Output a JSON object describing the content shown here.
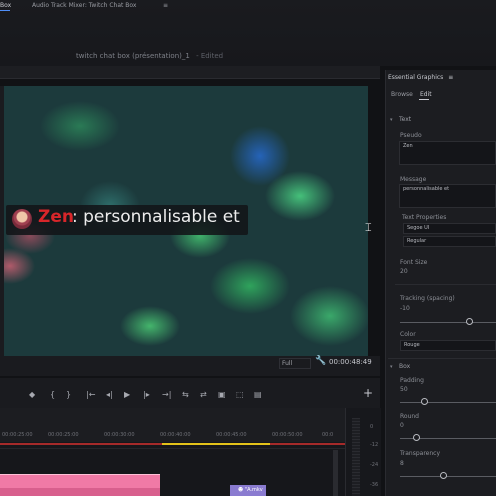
{
  "window": {
    "title": "twitch chat box (présentation)_1",
    "edited": "- Edited"
  },
  "monitor": {
    "tabs": [
      "Box",
      "Audio Track Mixer: Twitch Chat Box"
    ],
    "menu_icon": "≡",
    "fit": "Full",
    "timecode": "00:00:48:49",
    "overlay": {
      "username": "Zen",
      "message": ": personnalisable et",
      "username_color": "#d8262a"
    }
  },
  "transport": {
    "buttons": [
      "◆",
      "{",
      "}",
      "|←",
      "◂|",
      "▶",
      "|▸",
      "→|",
      "⇆",
      "⇄",
      "▣",
      "⬚",
      "▤"
    ],
    "add": "+"
  },
  "timeline": {
    "ticks": [
      "00:00:25:00",
      "00:00:30:00",
      "00:00:35:00",
      "00:00:40:00",
      "00:00:45:00",
      "00:00:50:00",
      "00:0"
    ],
    "clip_label": "☻ \"A.mkv"
  },
  "meters": {
    "labels": [
      "0",
      "-12",
      "-24",
      "-36"
    ]
  },
  "essential_graphics": {
    "title": "Essential Graphics",
    "menu_icon": "≡",
    "tabs": [
      "Browse",
      "Edit"
    ],
    "sections": {
      "text": {
        "title": "Text",
        "pseudo_label": "Pseudo",
        "pseudo_value": "Zen",
        "message_label": "Message",
        "message_value": "personnalisable et",
        "text_properties_label": "Text Properties",
        "font": "Segoe UI",
        "style": "Regular",
        "font_size_label": "Font Size",
        "font_size": "20",
        "tracking_label": "Tracking (spacing)",
        "tracking": "-10",
        "color_label": "Color",
        "color": "Rouge"
      },
      "box": {
        "title": "Box",
        "padding_label": "Padding",
        "padding": "50",
        "round_label": "Round",
        "round": "0",
        "transparency_label": "Transparency",
        "transparency": "8"
      }
    }
  },
  "colors": {
    "accent": "#4f8ef7",
    "timeline_work_area": "#e3c21a",
    "clip_pink": "#f07aa6",
    "clip_purple": "#8a7bd0"
  }
}
